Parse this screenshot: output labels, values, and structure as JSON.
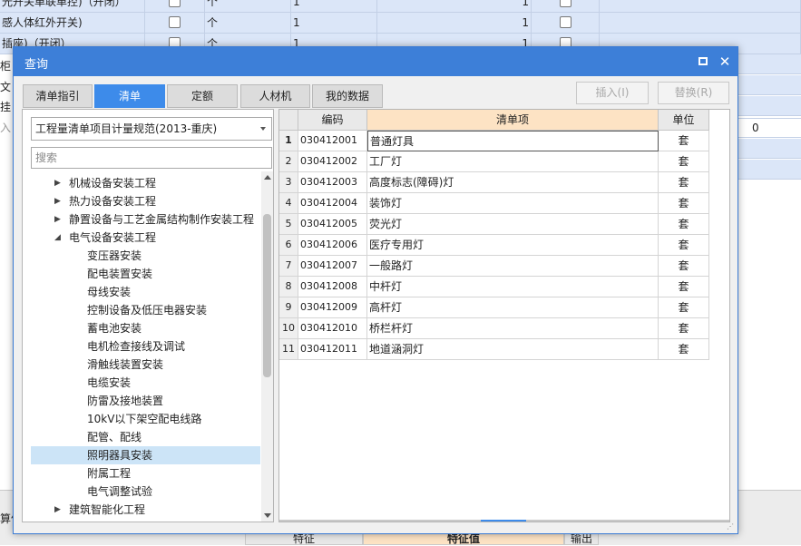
{
  "background": {
    "rows": [
      {
        "name": "光开关单联单控)（开闭）",
        "unit": "个",
        "qty": "1",
        "qty2": "1"
      },
      {
        "name": "感人体红外开关)",
        "unit": "个",
        "qty": "1",
        "qty2": "1"
      },
      {
        "name": "插座)（开闭）",
        "unit": "个",
        "qty": "1",
        "qty2": "1"
      }
    ],
    "side_labels": [
      "柜",
      "文",
      "挂",
      "入"
    ],
    "right_value": "0",
    "bottom_side_label": "算信",
    "bottom_headers": [
      "特征",
      "特征值",
      "输出"
    ]
  },
  "dialog": {
    "title": "查询",
    "tabs": [
      "清单指引",
      "清单",
      "定额",
      "人材机",
      "我的数据"
    ],
    "active_tab": "清单",
    "insert_button": "插入(I)",
    "replace_button": "替换(R)",
    "standard_select": "工程量清单项目计量规范(2013-重庆)",
    "search_placeholder": "搜索",
    "tree": [
      {
        "label": "机械设备安装工程",
        "level": 0,
        "arrow": "▶"
      },
      {
        "label": "热力设备安装工程",
        "level": 0,
        "arrow": "▶"
      },
      {
        "label": "静置设备与工艺金属结构制作安装工程",
        "level": 0,
        "arrow": "▶"
      },
      {
        "label": "电气设备安装工程",
        "level": 0,
        "arrow": "◢"
      },
      {
        "label": "变压器安装",
        "level": 1
      },
      {
        "label": "配电装置安装",
        "level": 1
      },
      {
        "label": "母线安装",
        "level": 1
      },
      {
        "label": "控制设备及低压电器安装",
        "level": 1
      },
      {
        "label": "蓄电池安装",
        "level": 1
      },
      {
        "label": "电机检查接线及调试",
        "level": 1
      },
      {
        "label": "滑触线装置安装",
        "level": 1
      },
      {
        "label": "电缆安装",
        "level": 1
      },
      {
        "label": "防雷及接地装置",
        "level": 1
      },
      {
        "label": "10kV以下架空配电线路",
        "level": 1
      },
      {
        "label": "配管、配线",
        "level": 1
      },
      {
        "label": "照明器具安装",
        "level": 1,
        "selected": true
      },
      {
        "label": "附属工程",
        "level": 1
      },
      {
        "label": "电气调整试验",
        "level": 1
      },
      {
        "label": "建筑智能化工程",
        "level": 0,
        "arrow": "▶"
      },
      {
        "label": "自动化控制仪表安装工程",
        "level": 0,
        "arrow": "▶"
      }
    ],
    "grid": {
      "headers": {
        "code": "编码",
        "name": "清单项",
        "unit": "单位"
      },
      "rows": [
        {
          "idx": "1",
          "code": "030412001",
          "name": "普通灯具",
          "unit": "套"
        },
        {
          "idx": "2",
          "code": "030412002",
          "name": "工厂灯",
          "unit": "套"
        },
        {
          "idx": "3",
          "code": "030412003",
          "name": "高度标志(障碍)灯",
          "unit": "套"
        },
        {
          "idx": "4",
          "code": "030412004",
          "name": "装饰灯",
          "unit": "套"
        },
        {
          "idx": "5",
          "code": "030412005",
          "name": "荧光灯",
          "unit": "套"
        },
        {
          "idx": "6",
          "code": "030412006",
          "name": "医疗专用灯",
          "unit": "套"
        },
        {
          "idx": "7",
          "code": "030412007",
          "name": "一般路灯",
          "unit": "套"
        },
        {
          "idx": "8",
          "code": "030412008",
          "name": "中杆灯",
          "unit": "套"
        },
        {
          "idx": "9",
          "code": "030412009",
          "name": "高杆灯",
          "unit": "套"
        },
        {
          "idx": "10",
          "code": "030412010",
          "name": "桥栏杆灯",
          "unit": "套"
        },
        {
          "idx": "11",
          "code": "030412011",
          "name": "地道涵洞灯",
          "unit": "套"
        }
      ]
    }
  },
  "colors": {
    "titlebar": "#3d7fd8",
    "active_tab": "#3d8bea",
    "selection": "#cce4f7",
    "header_main": "#fde3c4"
  }
}
